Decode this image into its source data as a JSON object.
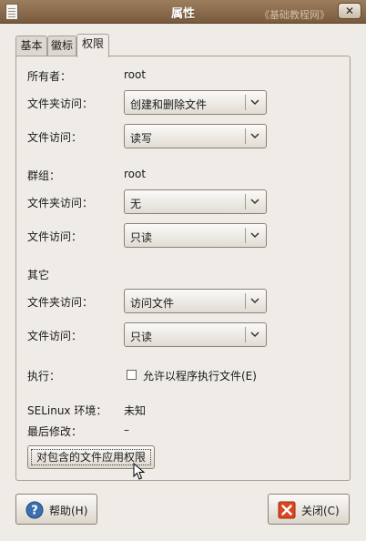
{
  "window": {
    "title": "属性",
    "watermark": "《基础教程网》",
    "close_glyph": "✕"
  },
  "tabs": [
    {
      "label": "基本",
      "active": false
    },
    {
      "label": "徽标",
      "active": false
    },
    {
      "label": "权限",
      "active": true
    }
  ],
  "owner": {
    "owner_label": "所有者：",
    "owner_value": "root",
    "folder_access_label": "文件夹访问：",
    "folder_access_value": "创建和删除文件",
    "file_access_label": "文件访问：",
    "file_access_value": "读写"
  },
  "group": {
    "group_label": "群组：",
    "group_value": "root",
    "folder_access_label": "文件夹访问：",
    "folder_access_value": "无",
    "file_access_label": "文件访问：",
    "file_access_value": "只读"
  },
  "others": {
    "section_label": "其它",
    "folder_access_label": "文件夹访问：",
    "folder_access_value": "访问文件",
    "file_access_label": "文件访问：",
    "file_access_value": "只读"
  },
  "execute": {
    "label": "执行：",
    "checkbox_label": "允许以程序执行文件(E)",
    "checked": false
  },
  "selinux": {
    "label": "SELinux 环境：",
    "value": "未知"
  },
  "modified": {
    "label": "最后修改：",
    "value": "–"
  },
  "apply_button": "对包含的文件应用权限",
  "buttons": {
    "help": "帮助(H)",
    "close": "关闭(C)"
  },
  "colors": {
    "titlebar": "#8a6c4e",
    "window_bg": "#efebe7",
    "help_icon": "#3d6fb0",
    "close_icon": "#d9461f"
  }
}
